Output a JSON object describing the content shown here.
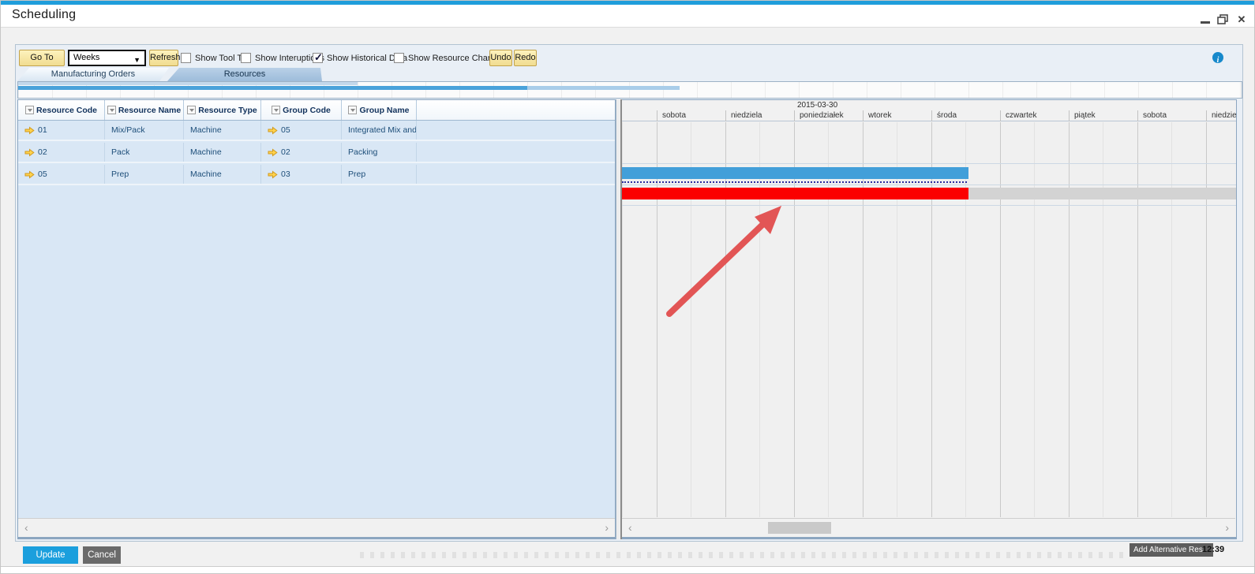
{
  "window": {
    "title": "Scheduling",
    "controls": {
      "close_glyph": "✕"
    }
  },
  "toolbar": {
    "go_to_today": "Go To Today",
    "interval_value": "Weeks",
    "refresh": "Refresh",
    "checkboxes": [
      {
        "label": "Show Tool Tip",
        "checked": false
      },
      {
        "label": "Show Interuptions",
        "checked": false
      },
      {
        "label": "Show Historical Data",
        "checked": true
      },
      {
        "label": "Show Resource Chart",
        "checked": false
      }
    ],
    "undo": "Undo",
    "redo": "Redo"
  },
  "tabs": {
    "manufacturing_orders": "Manufacturing Orders",
    "resources": "Resources",
    "selected": "Resources"
  },
  "resource_table": {
    "columns": [
      "Resource Code",
      "Resource Name",
      "Resource Type",
      "Group Code",
      "Group Name"
    ],
    "rows": [
      {
        "resource_code": "01",
        "resource_name": "Mix/Pack",
        "resource_type": "Machine",
        "group_code": "05",
        "group_name": "Integrated Mix and Pa"
      },
      {
        "resource_code": "02",
        "resource_name": "Pack",
        "resource_type": "Machine",
        "group_code": "02",
        "group_name": "Packing"
      },
      {
        "resource_code": "05",
        "resource_name": "Prep",
        "resource_type": "Machine",
        "group_code": "03",
        "group_name": "Prep"
      }
    ]
  },
  "gantt": {
    "date_label": "2015-03-30",
    "days": [
      "sobota",
      "niedziela",
      "poniedziałek",
      "wtorek",
      "środa",
      "czwartek",
      "piątek",
      "sobota",
      "niedziela"
    ],
    "bars": [
      {
        "row_resource": "Pack",
        "kind": "scheduled-task",
        "color": "#429fd9"
      },
      {
        "row_resource": "Prep",
        "kind": "selected-task",
        "color": "#fb0000"
      },
      {
        "row_resource": "Prep",
        "kind": "historical-extension",
        "color": "#d3d3d3"
      }
    ]
  },
  "scrollbars": {
    "left_glyph": "‹",
    "right_glyph": "›"
  },
  "footer": {
    "update": "Update",
    "cancel": "Cancel"
  },
  "taskbar": {
    "button": "Add Alternative Res...",
    "clock": "12:39"
  },
  "colors": {
    "accent": "#1f9ddb",
    "bar_blue": "#429fd9",
    "bar_red": "#fb0000",
    "bar_gray": "#d3d3d3",
    "update_blue": "#1b9fdd",
    "cancel_gray": "#6a6a6a"
  }
}
